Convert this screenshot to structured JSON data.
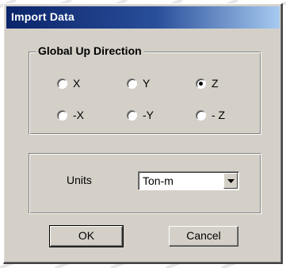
{
  "window": {
    "title": "Import Data"
  },
  "up_direction": {
    "legend": "Global Up Direction",
    "options": [
      {
        "label": "X",
        "checked": false
      },
      {
        "label": "Y",
        "checked": false
      },
      {
        "label": "Z",
        "checked": true
      },
      {
        "label": "-X",
        "checked": false
      },
      {
        "label": "-Y",
        "checked": false
      },
      {
        "label": "- Z",
        "checked": false
      }
    ]
  },
  "units": {
    "label": "Units",
    "selected": "Ton-m"
  },
  "buttons": {
    "ok": "OK",
    "cancel": "Cancel"
  },
  "colors": {
    "title_bar": "#0a246a",
    "dialog_face": "#d4d0c8"
  }
}
